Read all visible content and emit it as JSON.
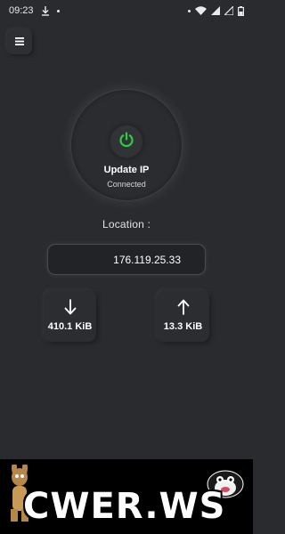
{
  "status_bar": {
    "time": "09:23",
    "icons": [
      "download-icon",
      "notification-dot-icon",
      "dot-icon",
      "wifi-icon",
      "signal-icon",
      "signal-icon",
      "battery-icon"
    ]
  },
  "menu": {
    "icon": "hamburger-menu-icon"
  },
  "power": {
    "title": "Update IP",
    "status": "Connected",
    "icon_color": "#2ecc40"
  },
  "location": {
    "label": "Location :",
    "ip": "176.119.25.33"
  },
  "stats": {
    "download": {
      "value": "410.1 KiB",
      "icon": "arrow-down-icon"
    },
    "upload": {
      "value": "13.3 KiB",
      "icon": "arrow-up-icon"
    }
  },
  "watermark": {
    "text": "CWER.WS"
  }
}
